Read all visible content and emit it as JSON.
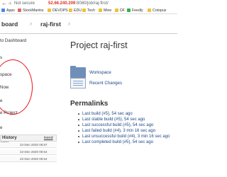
{
  "browser": {
    "secure_label": "Not secure",
    "url_ip": "52.66.240.209",
    "url_path": ":8080/job/raj-first/"
  },
  "bookmarks": [
    {
      "label": "Apps",
      "color": "#4a86e8"
    },
    {
      "label": "StockMantra",
      "color": "#e06666"
    },
    {
      "label": "DEVOPS",
      "color": "#f1c232"
    },
    {
      "label": "EDU",
      "color": "#f1c232"
    },
    {
      "label": "Tech",
      "color": "#f1c232"
    },
    {
      "label": "Mine",
      "color": "#f1c232"
    },
    {
      "label": "DF",
      "color": "#f1c232"
    },
    {
      "label": "Feedly",
      "color": "#2bb24c"
    },
    {
      "label": "Cotopus",
      "color": "#f1c232"
    }
  ],
  "header": {
    "crumb_dashboard": "board",
    "crumb_job": "raj-first"
  },
  "sidebar": {
    "tasks": [
      "to Dashboard",
      "s",
      "space",
      "Now",
      "e",
      "e Project",
      "e",
      "ame"
    ],
    "history_title": "History",
    "history_trend": "trend",
    "builds": [
      "22-Dec-2020 05:57",
      "22-Dec-2020 05:54",
      "22-Dec-2020 05:54"
    ]
  },
  "main": {
    "title": "Project raj-first",
    "workspace_link": "Workspace",
    "recent_changes_link": "Recent Changes",
    "permalinks_title": "Permalinks",
    "permalinks": [
      "Last build (#5), 54 sec ago",
      "Last stable build (#5), 54 sec ago",
      "Last successful build (#5), 54 sec ago",
      "Last failed build (#4), 3 min 16 sec ago",
      "Last unsuccessful build (#4), 3 min 16 sec ago",
      "Last completed build (#5), 54 sec ago"
    ]
  },
  "colors": {
    "link": "#204a87",
    "annotation_circle": "#e8131b",
    "success_ball": "#2d9a3d"
  }
}
